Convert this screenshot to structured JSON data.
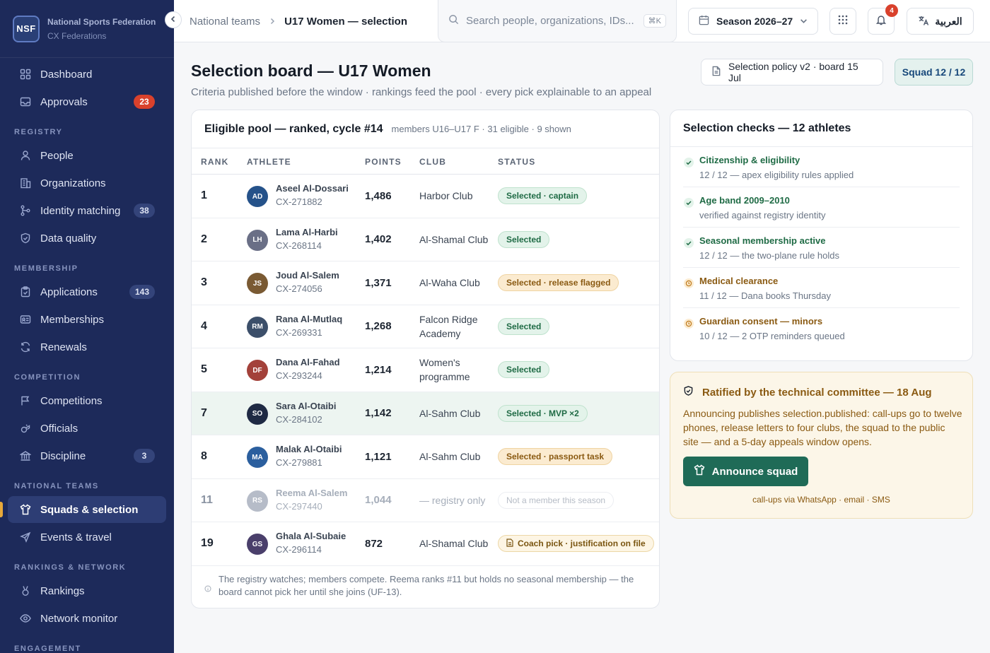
{
  "brand": {
    "logo": "NSF",
    "name": "National Sports Federation",
    "sub": "CX Federations"
  },
  "nav": {
    "dashboard": "Dashboard",
    "approvals": {
      "label": "Approvals",
      "count": "23"
    },
    "registry_section": "REGISTRY",
    "people": "People",
    "organizations": "Organizations",
    "identity": {
      "label": "Identity matching",
      "count": "38"
    },
    "data_quality": "Data quality",
    "membership_section": "MEMBERSHIP",
    "applications": {
      "label": "Applications",
      "count": "143"
    },
    "memberships": "Memberships",
    "renewals": "Renewals",
    "competition_section": "COMPETITION",
    "competitions": "Competitions",
    "officials": "Officials",
    "discipline": {
      "label": "Discipline",
      "count": "3"
    },
    "national_section": "NATIONAL TEAMS",
    "squads": "Squads & selection",
    "events": "Events & travel",
    "rankings_section": "RANKINGS & NETWORK",
    "rankings": "Rankings",
    "network": "Network monitor",
    "engagement_section": "ENGAGEMENT"
  },
  "topbar": {
    "breadcrumb_1": "National teams",
    "breadcrumb_2": "U17 Women — selection",
    "search_placeholder": "Search people, organizations, IDs...",
    "search_shortcut": "⌘K",
    "season": "Season 2026–27",
    "notifications_count": "4",
    "language": "العربية"
  },
  "page": {
    "title": "Selection board — U17 Women",
    "subtitle": "Criteria published before the window · rankings feed the pool · every pick explainable to an appeal",
    "policy_button": "Selection policy v2 · board 15 Jul",
    "squad_badge": "Squad 12 / 12"
  },
  "pool": {
    "title": "Eligible pool — ranked, cycle #14",
    "meta": "members U16–U17 F · 31 eligible · 9 shown",
    "columns": {
      "rank": "RANK",
      "athlete": "ATHLETE",
      "points": "POINTS",
      "club": "CLUB",
      "status": "STATUS"
    },
    "rows": [
      {
        "rank": "1",
        "initials": "AD",
        "name": "Aseel Al-Dossari",
        "id": "CX-271882",
        "points": "1,486",
        "club": "Harbor Club",
        "status": "Selected · captain"
      },
      {
        "rank": "2",
        "initials": "LH",
        "name": "Lama Al-Harbi",
        "id": "CX-268114",
        "points": "1,402",
        "club": "Al-Shamal Club",
        "status": "Selected"
      },
      {
        "rank": "3",
        "initials": "JS",
        "name": "Joud Al-Salem",
        "id": "CX-274056",
        "points": "1,371",
        "club": "Al-Waha Club",
        "status": "Selected · release flagged"
      },
      {
        "rank": "4",
        "initials": "RM",
        "name": "Rana Al-Mutlaq",
        "id": "CX-269331",
        "points": "1,268",
        "club": "Falcon Ridge Academy",
        "status": "Selected"
      },
      {
        "rank": "5",
        "initials": "DF",
        "name": "Dana Al-Fahad",
        "id": "CX-293244",
        "points": "1,214",
        "club": "Women's programme",
        "status": "Selected"
      },
      {
        "rank": "7",
        "initials": "SO",
        "name": "Sara Al-Otaibi",
        "id": "CX-284102",
        "points": "1,142",
        "club": "Al-Sahm Club",
        "status": "Selected · MVP ×2"
      },
      {
        "rank": "8",
        "initials": "MA",
        "name": "Malak Al-Otaibi",
        "id": "CX-279881",
        "points": "1,121",
        "club": "Al-Sahm Club",
        "status": "Selected · passport task"
      },
      {
        "rank": "11",
        "initials": "RS",
        "name": "Reema Al-Salem",
        "id": "CX-297440",
        "points": "1,044",
        "club": "— registry only",
        "status": "Not a member this season"
      },
      {
        "rank": "19",
        "initials": "GS",
        "name": "Ghala Al-Subaie",
        "id": "CX-296114",
        "points": "872",
        "club": "Al-Shamal Club",
        "status": "Coach pick · justification on file"
      }
    ],
    "footnote": "The registry watches; members compete. Reema ranks #11 but holds no seasonal membership — the board cannot pick her until she joins (UF-13)."
  },
  "checks": {
    "title": "Selection checks — 12 athletes",
    "items": [
      {
        "title": "Citizenship & eligibility",
        "detail": "12 / 12 — apex eligibility rules applied"
      },
      {
        "title": "Age band 2009–2010",
        "detail": "verified against registry identity"
      },
      {
        "title": "Seasonal membership active",
        "detail": "12 / 12 — the two-plane rule holds"
      },
      {
        "title": "Medical clearance",
        "detail": "11 / 12 — Dana books Thursday"
      },
      {
        "title": "Guardian consent — minors",
        "detail": "10 / 12 — 2 OTP reminders queued"
      }
    ]
  },
  "ratify": {
    "title": "Ratified by the technical committee — 18 Aug",
    "body": "Announcing publishes selection.published: call-ups go to twelve phones, release letters to four clubs, the squad to the public site — and a 5-day appeals window opens.",
    "button": "Announce squad",
    "footer": "call-ups via WhatsApp · email · SMS"
  },
  "colors": {
    "sidebar": "#1d2a5a",
    "accent_green": "#1f6b57",
    "status_green": "#1f6b45",
    "status_amber": "#8a5a12",
    "badge_red": "#d9412c"
  }
}
